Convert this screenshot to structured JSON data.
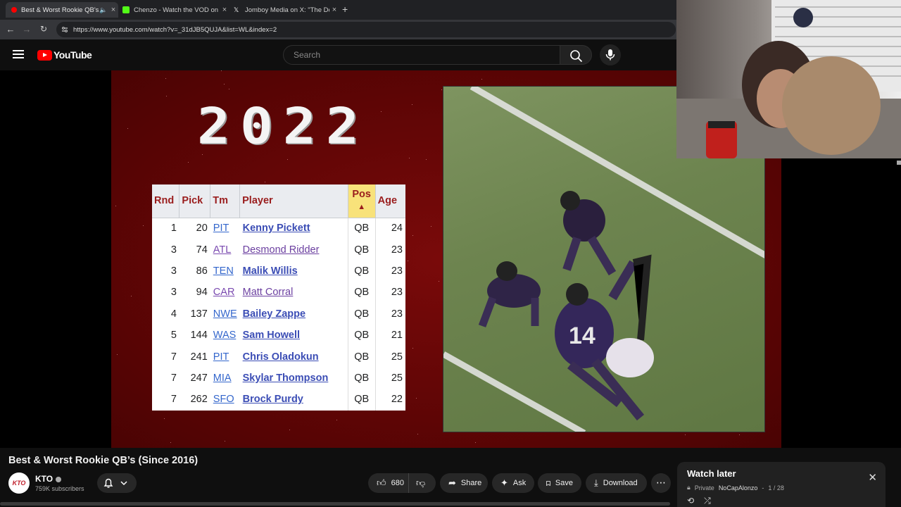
{
  "browser": {
    "tabs": [
      {
        "title": "Best & Worst Rookie QB's (",
        "active": true,
        "favicon": "youtube-icon",
        "color": "#ff0000"
      },
      {
        "title": "Chenzo - Watch the VOD on Ki",
        "active": false,
        "favicon": "kick-icon",
        "color": "#53fc18"
      },
      {
        "title": "Jomboy Media on X: \"The Dodg",
        "active": false,
        "favicon": "x-icon",
        "color": "#ffffff"
      }
    ],
    "new_tab": "+",
    "url": "https://www.youtube.com/watch?v=_31dJB5QUJA&list=WL&index=2"
  },
  "youtube": {
    "logo_text": "YouTube",
    "search_placeholder": "Search"
  },
  "video_frame": {
    "year": "2022",
    "table": {
      "headers": [
        "Rnd",
        "Pick",
        "Tm",
        "Player",
        "Pos",
        "Age"
      ],
      "sort_indicator": "▲",
      "rows": [
        {
          "rnd": "1",
          "pick": "20",
          "tm": "PIT",
          "player": "Kenny Pickett",
          "pos": "QB",
          "age": "24",
          "visited": false
        },
        {
          "rnd": "3",
          "pick": "74",
          "tm": "ATL",
          "player": "Desmond Ridder",
          "pos": "QB",
          "age": "23",
          "visited": true
        },
        {
          "rnd": "3",
          "pick": "86",
          "tm": "TEN",
          "player": "Malik Willis",
          "pos": "QB",
          "age": "23",
          "visited": false
        },
        {
          "rnd": "3",
          "pick": "94",
          "tm": "CAR",
          "player": "Matt Corral",
          "pos": "QB",
          "age": "23",
          "visited": true
        },
        {
          "rnd": "4",
          "pick": "137",
          "tm": "NWE",
          "player": "Bailey Zappe",
          "pos": "QB",
          "age": "23",
          "visited": false
        },
        {
          "rnd": "5",
          "pick": "144",
          "tm": "WAS",
          "player": "Sam Howell",
          "pos": "QB",
          "age": "21",
          "visited": false
        },
        {
          "rnd": "7",
          "pick": "241",
          "tm": "PIT",
          "player": "Chris Oladokun",
          "pos": "QB",
          "age": "25",
          "visited": false
        },
        {
          "rnd": "7",
          "pick": "247",
          "tm": "MIA",
          "player": "Skylar Thompson",
          "pos": "QB",
          "age": "25",
          "visited": false
        },
        {
          "rnd": "7",
          "pick": "262",
          "tm": "SFO",
          "player": "Brock Purdy",
          "pos": "QB",
          "age": "22",
          "visited": false
        }
      ]
    },
    "jersey_number": "14"
  },
  "video": {
    "title": "Best & Worst Rookie QB’s (Since 2016)",
    "channel": "KTO",
    "avatar_text": "KTO",
    "subscribers": "759K subscribers",
    "likes": "680",
    "share_label": "Share",
    "ask_label": "Ask",
    "save_label": "Save",
    "download_label": "Download",
    "more": "⋯"
  },
  "watch_later": {
    "title": "Watch later",
    "privacy": "Private",
    "owner": "NoCapAlonzo",
    "position": "1 / 28"
  }
}
